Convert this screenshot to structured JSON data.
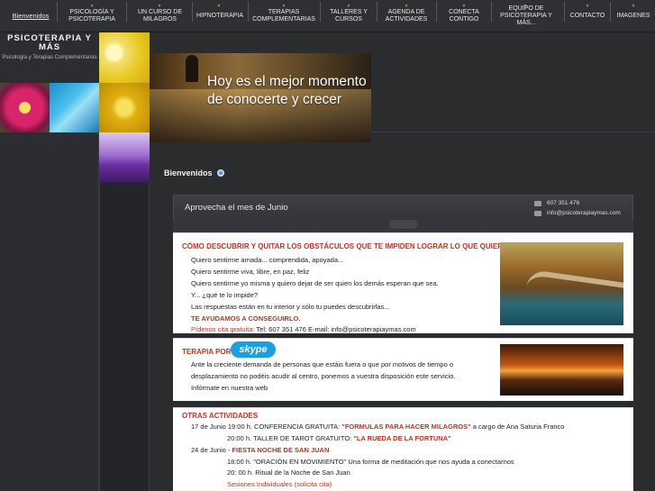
{
  "nav": {
    "items": [
      {
        "label": "Bienvenidos"
      },
      {
        "label": "PSICOLOGÍA Y PSICOTERAPIA"
      },
      {
        "label": "UN CURSO DE MILAGROS"
      },
      {
        "label": "HIPNOTERAPIA"
      },
      {
        "label": "TERAPIAS COMPLEMENTARIAS"
      },
      {
        "label": "TALLERES Y CURSOS"
      },
      {
        "label": "AGENDA DE ACTIVIDADES"
      },
      {
        "label": "CONECTA CONTIGO"
      },
      {
        "label": "EQUIPO DE PSICOTERAPIA Y MÁS..."
      },
      {
        "label": "CONTACTO"
      },
      {
        "label": "IMAGENES"
      }
    ],
    "accent": "#e07a20"
  },
  "brand": {
    "title": "PSICOTERAPIA Y MÁS",
    "subtitle": "Psicología y Terapias Complementarias"
  },
  "banner": {
    "line1": "Hoy es el mejor momento",
    "line2": "de conocerte y crecer"
  },
  "welcome": "Bienvenidos",
  "promo": {
    "title": "Aprovecha el mes de Junio",
    "phone": "607 351 476",
    "email": "info@psicoterapiaymas.com"
  },
  "card1": {
    "heading": "CÓMO DESCUBRIR Y QUITAR LOS OBSTÁCULOS QUE TE IMPIDEN LOGRAR LO QUE QUIERES",
    "lines": [
      "Quiero sentirme amada... comprendida, apoyada...",
      "Quiero sentirme viva, libre, en paz, feliz",
      "Quiero sentirme yo misma y quiero dejar de ser quien los demás esperan que sea.",
      "Y... ¿qué te lo impide?",
      "Las respuestas están en tu interior y sólo tu puedes descubrirlas..."
    ],
    "cta": "TE AYUDAMOS A CONSEGUIRLO.",
    "cita_label": "Pídenos cita gratuita:",
    "cita_text": " Tel: 607 351 476  E-mail: info@psicoterapiaymas.com"
  },
  "card2": {
    "heading": "TERAPIA POR",
    "skype": "skype",
    "lines": [
      "Ante la creciente demanda de personas que estáis fuera o que por motivos de tiempo o",
      "desplazamiento no podéis acudir al centro, ponemos a vuestra disposición este servicio.",
      "Infórmate en nuestra web"
    ]
  },
  "card3": {
    "heading": "OTRAS ACTIVIDADES",
    "r1_a": "17 de Junio 19:00 h. CONFERENCIA GRATUITA: ",
    "r1_b": "\"FORMULAS PARA HACER MILAGROS\"",
    "r1_c": " a cargo de Ana Saturia Franco",
    "r2_a": "20:00 h. TALLER DE TAROT GRATUITO: ",
    "r2_b": "\"LA RUEDA DE LA FORTUNA\"",
    "r3_a": "24 de Junio - ",
    "r3_b": "FIESTA NOCHE DE SAN JUAN",
    "r4": "18:00 h. \"ORACIÓN EN MOVIMIENTO\" Una forma de meditación que nos ayuda a conectarnos",
    "r5": "20: 00 h. Ritual de la Noche de San Juan",
    "r6": "Sesiones Individuales (solicita cita)"
  }
}
